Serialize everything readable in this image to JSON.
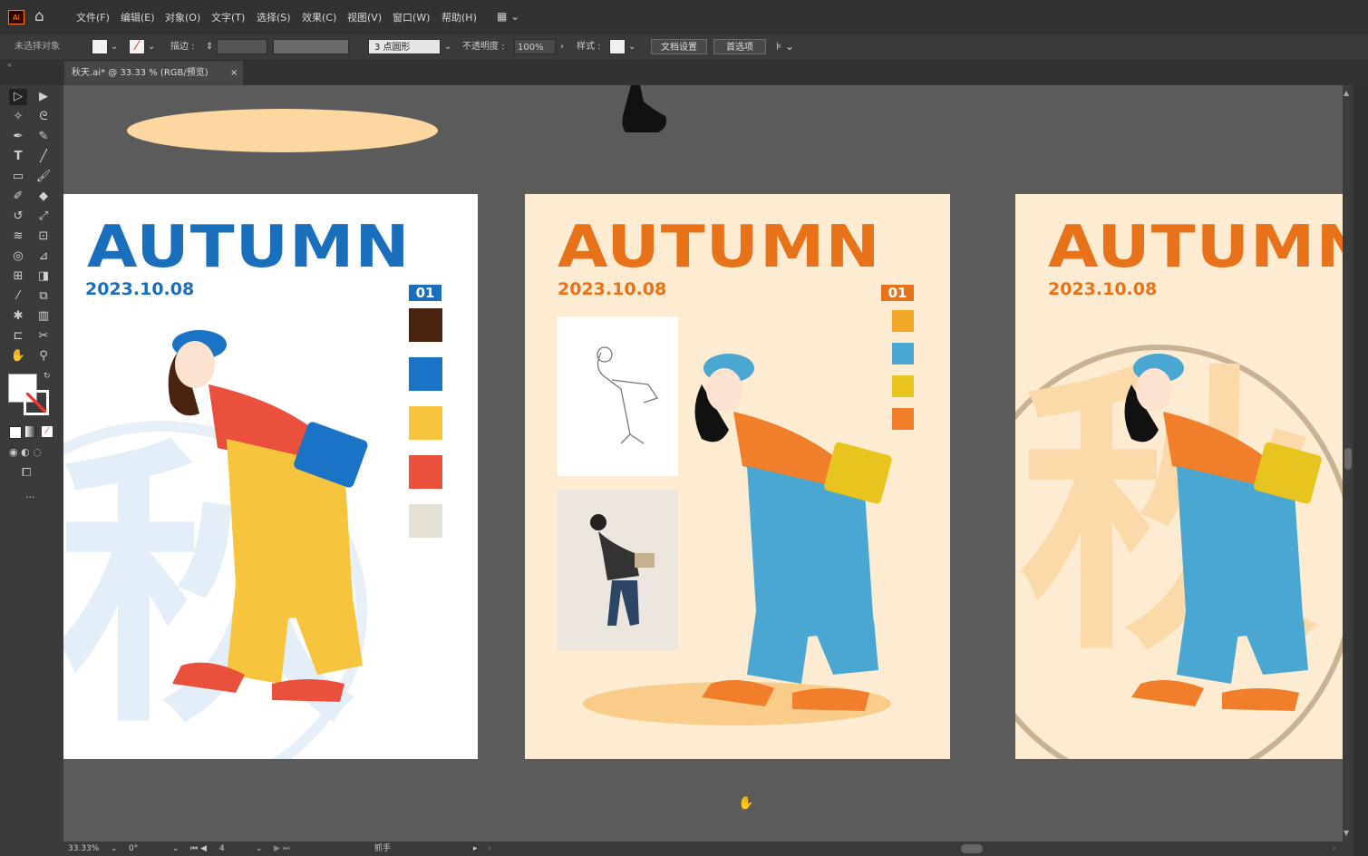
{
  "app": {
    "logo": "Ai",
    "home_icon": "home-icon"
  },
  "menu": [
    "文件(F)",
    "编辑(E)",
    "对象(O)",
    "文字(T)",
    "选择(S)",
    "效果(C)",
    "视图(V)",
    "窗口(W)",
    "帮助(H)"
  ],
  "control": {
    "selection_status": "未选择对象",
    "stroke_label": "描边 :",
    "brush": "3 点圆形",
    "opacity_label": "不透明度 :",
    "opacity_value": "100%",
    "style_label": "样式 :",
    "doc_setup": "文档设置",
    "preferences": "首选项"
  },
  "tab": {
    "title": "秋天.ai* @ 33.33 % (RGB/预览)",
    "close": "×"
  },
  "artboards": [
    {
      "title": "AUTUMN",
      "date": "2023.10.08",
      "badge": "01",
      "watermark": "秋",
      "title_color": "#1a6fbd",
      "bg": "#ffffff",
      "swatches": [
        "#4a2210",
        "#1a73c4",
        "#f7c53d",
        "#e9513d",
        "#e4e0d6"
      ]
    },
    {
      "title": "AUTUMN",
      "date": "2023.10.08",
      "badge": "01",
      "title_color": "#e8721a",
      "bg": "#fdecd2",
      "swatches": [
        "#f3a928",
        "#4aa7d1",
        "#e8c41e",
        "#f07e2a"
      ]
    },
    {
      "title": "AUTUMN",
      "date": "2023.10.08",
      "watermark": "秋",
      "title_color": "#e8721a",
      "bg": "#fdecd2"
    }
  ],
  "status": {
    "zoom": "33.33%",
    "rotation": "0°",
    "artboard": "4",
    "tool": "抓手"
  },
  "colors": {
    "menubar": "#323232",
    "panel": "#3b3b3b",
    "canvas": "#5b5b5b",
    "accent_orange": "#e8721a",
    "accent_blue": "#1a6fbd"
  }
}
